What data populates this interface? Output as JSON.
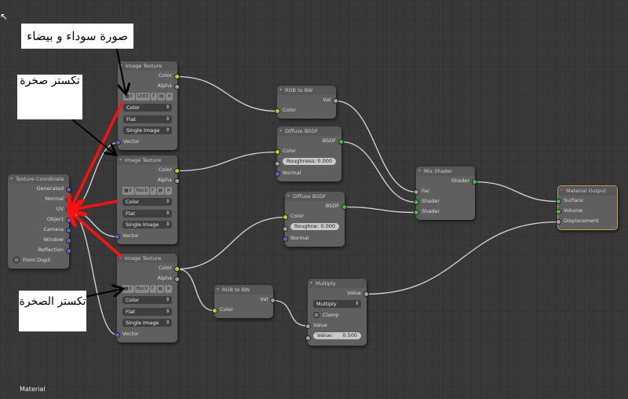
{
  "editor_label": "Material",
  "annotations": {
    "bw_image": "صورة سوداء و بيضاء",
    "rock_texture": "تكستر صخرة",
    "the_rock_texture": "تكستر الصخرة"
  },
  "colors": {
    "color_socket": "#c7c729",
    "shader_socket": "#3fbf3f",
    "vector_socket": "#6363c7",
    "value_socket": "#a1a1a1",
    "annotation_red": "#ff1010",
    "output_border": "#c89a4a"
  },
  "nodes": [
    {
      "id": "tex1",
      "title": "Image Texture",
      "rows": [
        {
          "t": "out",
          "l": "Color",
          "s": "color"
        },
        {
          "t": "out",
          "l": "Alpha",
          "s": "value"
        },
        {
          "t": "img",
          "v": "Untit"
        },
        {
          "t": "sel",
          "l": "Color"
        },
        {
          "t": "sel",
          "l": "Flat"
        },
        {
          "t": "sel",
          "l": "Single Image"
        },
        {
          "t": "in",
          "l": "Vector",
          "s": "vector"
        }
      ]
    },
    {
      "id": "tex2",
      "title": "Image Texture",
      "rows": [
        {
          "t": "out",
          "l": "Color",
          "s": "color"
        },
        {
          "t": "out",
          "l": "Alpha",
          "s": "value"
        },
        {
          "t": "img",
          "v": "Rock"
        },
        {
          "t": "sel",
          "l": "Color"
        },
        {
          "t": "sel",
          "l": "Flat"
        },
        {
          "t": "sel",
          "l": "Single Image"
        },
        {
          "t": "in",
          "l": "Vector",
          "s": "vector"
        }
      ]
    },
    {
      "id": "tex3",
      "title": "Image Texture",
      "rows": [
        {
          "t": "out",
          "l": "Color",
          "s": "color"
        },
        {
          "t": "out",
          "l": "Alpha",
          "s": "value"
        },
        {
          "t": "img",
          "v": "Rock"
        },
        {
          "t": "sel",
          "l": "Color"
        },
        {
          "t": "sel",
          "l": "Flat"
        },
        {
          "t": "sel",
          "l": "Single Image"
        },
        {
          "t": "in",
          "l": "Vector",
          "s": "vector"
        }
      ]
    },
    {
      "id": "texco",
      "title": "Texture Coordinate",
      "rows": [
        {
          "t": "out",
          "l": "Generated",
          "s": "vector"
        },
        {
          "t": "out",
          "l": "Normal",
          "s": "vector"
        },
        {
          "t": "out",
          "l": "UV",
          "s": "vector"
        },
        {
          "t": "out",
          "l": "Object",
          "s": "vector"
        },
        {
          "t": "out",
          "l": "Camera",
          "s": "vector"
        },
        {
          "t": "out",
          "l": "Window",
          "s": "vector"
        },
        {
          "t": "out",
          "l": "Reflection",
          "s": "vector"
        },
        {
          "t": "chk",
          "l": "From Dupli"
        }
      ]
    },
    {
      "id": "rgb1",
      "title": "RGB to BW",
      "rows": [
        {
          "t": "out",
          "l": "Val",
          "s": "value"
        },
        {
          "t": "in",
          "l": "Color",
          "s": "color"
        }
      ]
    },
    {
      "id": "diff1",
      "title": "Diffuse BSDF",
      "rows": [
        {
          "t": "out",
          "l": "BSDF",
          "s": "shader"
        },
        {
          "t": "in",
          "l": "Color",
          "s": "color"
        },
        {
          "t": "fld",
          "l": "Roughness:",
          "v": "0.000",
          "s": "value"
        },
        {
          "t": "in",
          "l": "Normal",
          "s": "vector"
        }
      ]
    },
    {
      "id": "diff2",
      "title": "Diffuse BSDF",
      "rows": [
        {
          "t": "out",
          "l": "BSDF",
          "s": "shader"
        },
        {
          "t": "in",
          "l": "Color",
          "s": "color"
        },
        {
          "t": "fld",
          "l": "Roughne:",
          "v": "0.000",
          "s": "value"
        },
        {
          "t": "in",
          "l": "Normal",
          "s": "vector"
        }
      ]
    },
    {
      "id": "mix",
      "title": "Mix Shader",
      "rows": [
        {
          "t": "out",
          "l": "Shader",
          "s": "shader"
        },
        {
          "t": "in",
          "l": "Fac",
          "s": "value"
        },
        {
          "t": "in",
          "l": "Shader",
          "s": "shader"
        },
        {
          "t": "in",
          "l": "Shader",
          "s": "shader"
        }
      ]
    },
    {
      "id": "matout",
      "title": "Material Output",
      "rows": [
        {
          "t": "in",
          "l": "Surface",
          "s": "shader"
        },
        {
          "t": "in",
          "l": "Volume",
          "s": "shader"
        },
        {
          "t": "in",
          "l": "Displacement",
          "s": "value"
        }
      ]
    },
    {
      "id": "rgb2",
      "title": "RGB to BW",
      "rows": [
        {
          "t": "out",
          "l": "Val",
          "s": "value"
        },
        {
          "t": "in",
          "l": "Color",
          "s": "color"
        }
      ]
    },
    {
      "id": "mult",
      "title": "Multiply",
      "rows": [
        {
          "t": "out",
          "l": "Value",
          "s": "value"
        },
        {
          "t": "sel",
          "l": "Multiply"
        },
        {
          "t": "chk",
          "l": "Clamp"
        },
        {
          "t": "in",
          "l": "Value",
          "s": "value"
        },
        {
          "t": "fld",
          "l": "Value:",
          "v": "0.500",
          "s": "value"
        }
      ]
    }
  ],
  "links": [
    [
      "tex1",
      0,
      "rgb1",
      1
    ],
    [
      "tex2",
      0,
      "diff1",
      1
    ],
    [
      "tex3",
      0,
      "diff2",
      1
    ],
    [
      "tex3",
      0,
      "rgb2",
      1
    ],
    [
      "rgb1",
      0,
      "mix",
      1
    ],
    [
      "diff1",
      0,
      "mix",
      2
    ],
    [
      "diff2",
      0,
      "mix",
      3
    ],
    [
      "mix",
      0,
      "matout",
      0
    ],
    [
      "rgb2",
      0,
      "mult",
      3
    ],
    [
      "mult",
      0,
      "matout",
      2
    ],
    [
      "texco",
      2,
      "tex1",
      6
    ],
    [
      "texco",
      2,
      "tex2",
      6
    ],
    [
      "texco",
      2,
      "tex3",
      6
    ]
  ]
}
